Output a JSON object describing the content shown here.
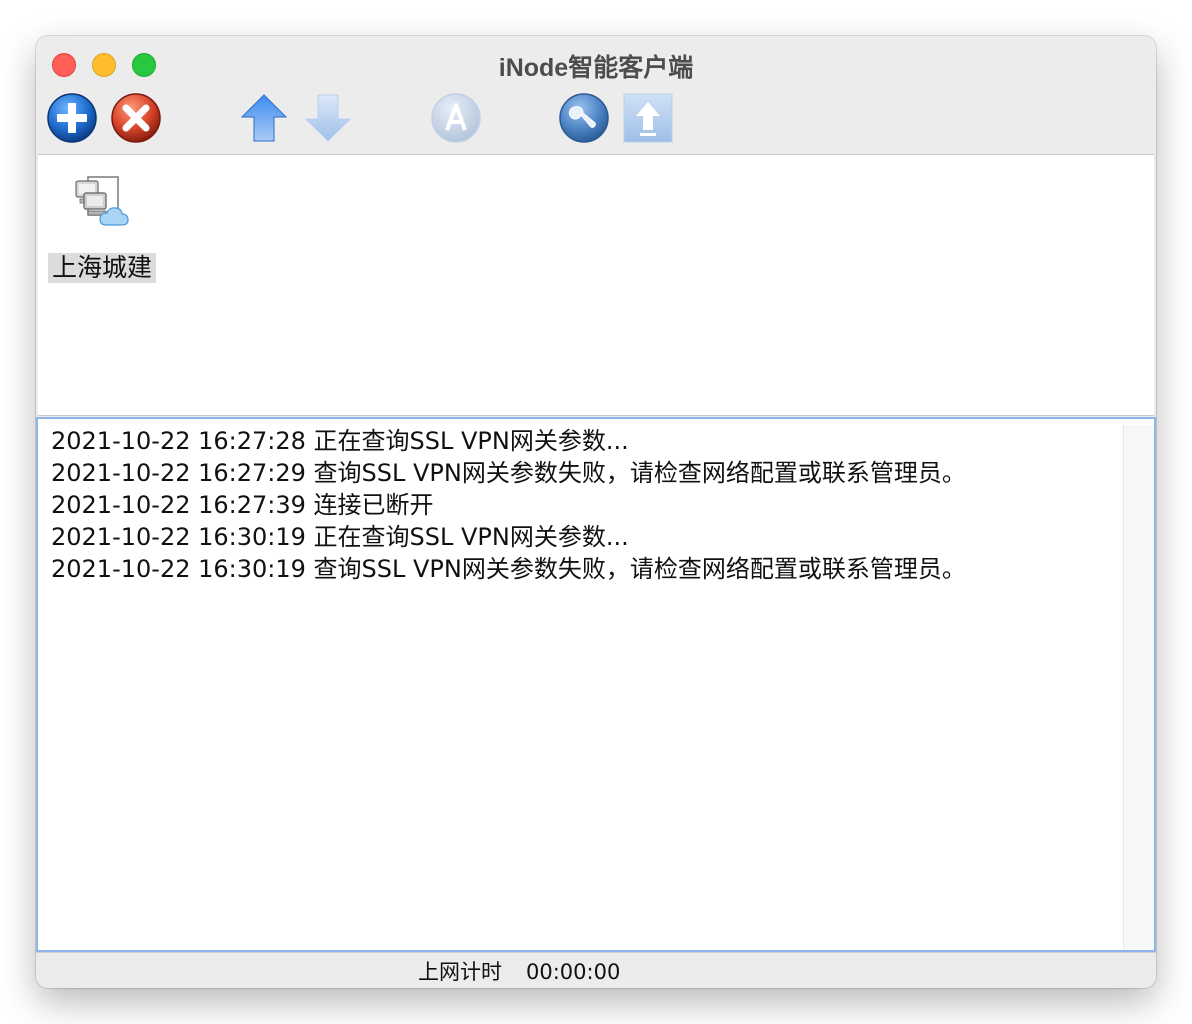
{
  "window": {
    "title": "iNode智能客户端"
  },
  "toolbar": {
    "buttons": [
      {
        "name": "add-connection",
        "icon": "plus-circle-icon",
        "enabled": true
      },
      {
        "name": "delete-connection",
        "icon": "delete-x-icon",
        "enabled": true
      },
      {
        "name": "move-up",
        "icon": "arrow-up-icon",
        "enabled": true
      },
      {
        "name": "move-down",
        "icon": "arrow-down-icon",
        "enabled": false
      },
      {
        "name": "auto-connect",
        "icon": "a-circle-icon",
        "enabled": false
      },
      {
        "name": "tools",
        "icon": "wrench-icon",
        "enabled": true
      },
      {
        "name": "upload",
        "icon": "upload-arrow-icon",
        "enabled": false
      }
    ]
  },
  "connections": [
    {
      "label": "上海城建",
      "icon": "network-computers-cloud-icon",
      "selected": true
    }
  ],
  "log": {
    "lines": [
      "2021-10-22 16:27:28 正在查询SSL VPN网关参数...",
      "2021-10-22 16:27:29 查询SSL VPN网关参数失败，请检查网络配置或联系管理员。",
      "2021-10-22 16:27:39 连接已断开",
      "2021-10-22 16:30:19 正在查询SSL VPN网关参数...",
      "2021-10-22 16:30:19 查询SSL VPN网关参数失败，请检查网络配置或联系管理员。"
    ]
  },
  "status": {
    "label": "上网计时",
    "timer": "00:00:00"
  },
  "colors": {
    "accent_blue": "#1f6fd1",
    "delete_red": "#d9452b",
    "log_border": "#8fb4ea"
  }
}
